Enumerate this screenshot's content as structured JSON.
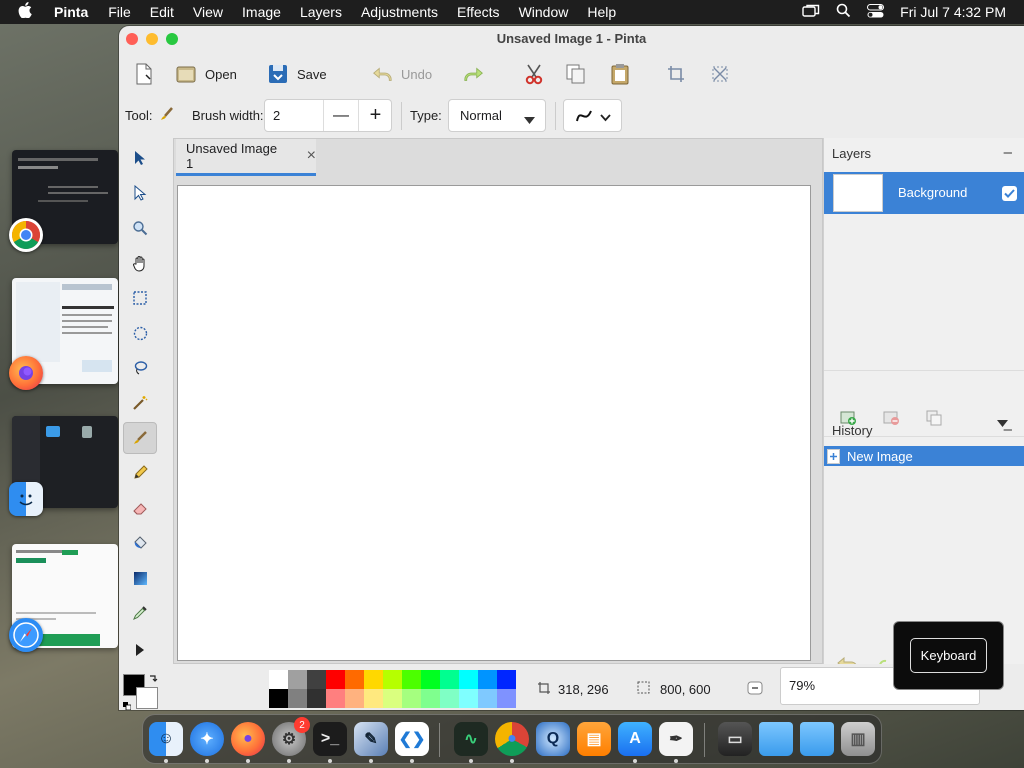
{
  "menubar": {
    "app_name": "Pinta",
    "items": [
      "File",
      "Edit",
      "View",
      "Image",
      "Layers",
      "Adjustments",
      "Effects",
      "Window",
      "Help"
    ],
    "clock": "Fri Jul 7  4:32 PM",
    "status_icons": [
      "screen-mirroring-icon",
      "spotlight-search-icon",
      "control-center-icon"
    ]
  },
  "window": {
    "title": "Unsaved Image 1 - Pinta"
  },
  "toolbar": {
    "new_label": "",
    "open_label": "Open",
    "save_label": "Save",
    "undo_label": "Undo",
    "redo_label": ""
  },
  "options": {
    "tool_label": "Tool:",
    "brush_width_label": "Brush width:",
    "brush_width_value": "2",
    "minus": "—",
    "plus": "+",
    "type_label": "Type:",
    "type_value": "Normal"
  },
  "document": {
    "tab_label": "Unsaved Image 1",
    "close_glyph": "×"
  },
  "layers": {
    "title": "Layers",
    "collapse": "–",
    "items": [
      {
        "name": "Background",
        "visible": true
      }
    ]
  },
  "history": {
    "title": "History",
    "collapse": "–",
    "items": [
      "New Image"
    ]
  },
  "status": {
    "cursor_position": "318, 296",
    "image_size": "800, 600",
    "zoom": "79%"
  },
  "palette": {
    "primary": "#000000",
    "secondary": "#ffffff",
    "top_row": [
      "#ffffff",
      "#a0a0a0",
      "#404040",
      "#ff0000",
      "#ff6a00",
      "#ffd800",
      "#b6ff00",
      "#4cff00",
      "#00ff21",
      "#00ff90",
      "#00ffff",
      "#0094ff",
      "#0026ff"
    ],
    "bottom_row": [
      "#000000",
      "#808080",
      "#303030",
      "#ff7f7f",
      "#ffb27f",
      "#ffe97f",
      "#daff7f",
      "#a5ff7f",
      "#7fff8e",
      "#7fffc5",
      "#7fffff",
      "#7fc9ff",
      "#7f92ff"
    ]
  },
  "popup": {
    "keyboard_label": "Keyboard"
  },
  "dock": {
    "apps": [
      "finder-icon",
      "safari-icon",
      "firefox-icon",
      "system-settings-icon",
      "terminal-icon",
      "pinta-icon",
      "vscode-icon",
      "activity-monitor-icon",
      "chrome-icon",
      "quicktime-icon",
      "books-icon",
      "app-store-icon",
      "script-editor-icon",
      "screenshot-icon",
      "folder-icon",
      "downloads-folder-icon",
      "trash-icon"
    ],
    "settings_badge": "2"
  },
  "colors": {
    "accent": "#3b82d6",
    "close": "#ff5f57",
    "minimize": "#febc2e",
    "zoom": "#28c840"
  }
}
